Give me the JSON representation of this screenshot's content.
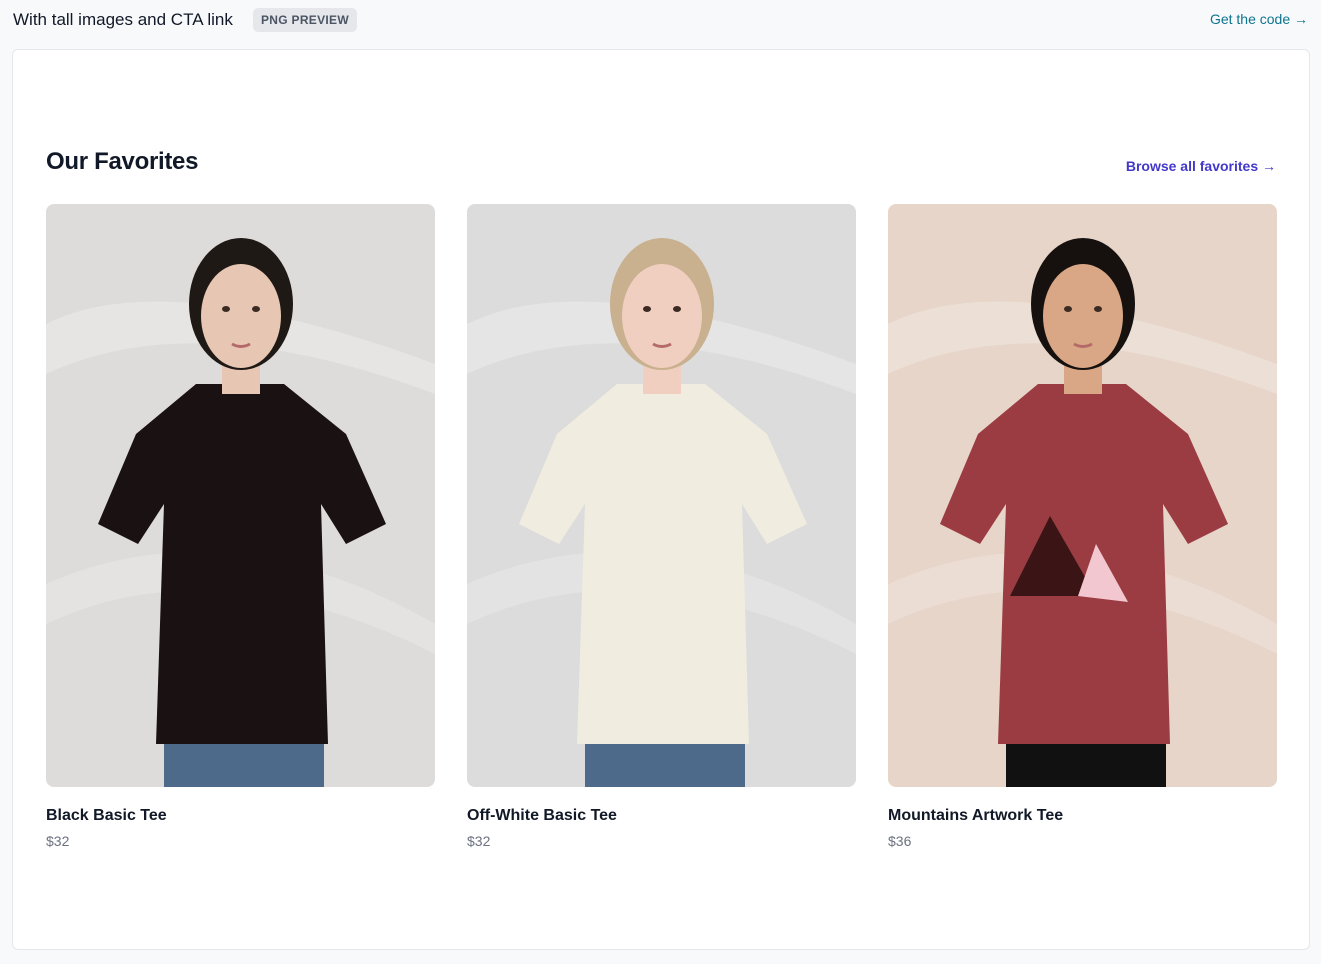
{
  "header": {
    "title": "With tall images and CTA link",
    "badge": "PNG PREVIEW",
    "code_link": "Get the code →"
  },
  "section": {
    "title": "Our Favorites",
    "browse_link": "Browse all favorites →"
  },
  "products": [
    {
      "name": "Black Basic Tee",
      "price": "$32",
      "shirt_color": "#1a1212",
      "backdrop": "#dedcda",
      "skin": "#e7c7b3",
      "hair": "#1f1915"
    },
    {
      "name": "Off-White Basic Tee",
      "price": "$32",
      "shirt_color": "#f0ece0",
      "backdrop": "#dcdcdc",
      "skin": "#f0cfc0",
      "hair": "#c9b08e"
    },
    {
      "name": "Mountains Artwork Tee",
      "price": "$36",
      "shirt_color": "#9b3c42",
      "backdrop": "#e6d5c8",
      "skin": "#d9a785",
      "hair": "#16110f"
    }
  ]
}
